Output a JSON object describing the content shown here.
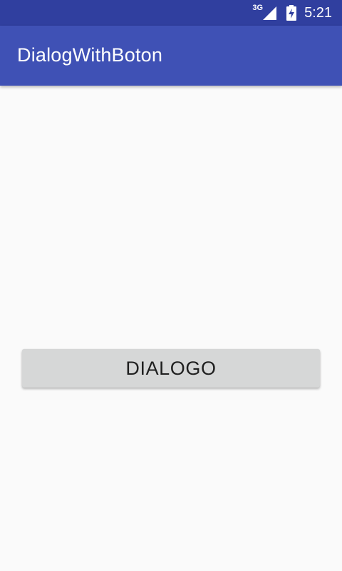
{
  "status_bar": {
    "network_type": "3G",
    "time": "5:21",
    "icons": [
      "signal-icon",
      "battery-charging-icon"
    ]
  },
  "app_bar": {
    "title": "DialogWithBoton"
  },
  "main": {
    "dialog_button_label": "DIALOGO"
  },
  "colors": {
    "status_bar": "#303f9f",
    "app_bar": "#3f51b5",
    "background": "#fafafa",
    "button": "#d6d7d7",
    "button_text": "#1f1f1f"
  }
}
